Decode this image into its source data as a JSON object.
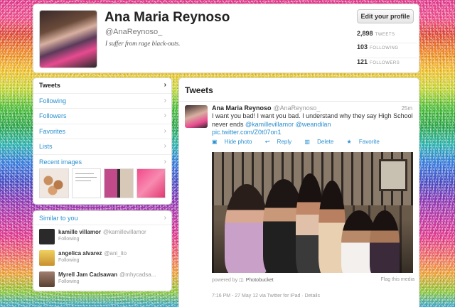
{
  "profile": {
    "name": "Ana Maria Reynoso",
    "handle": "@AnaReynoso_",
    "bio": "I suffer from rage black-outs.",
    "edit_label": "Edit your profile",
    "stats": [
      {
        "value": "2,898",
        "label": "TWEETS"
      },
      {
        "value": "103",
        "label": "FOLLOWING"
      },
      {
        "value": "121",
        "label": "FOLLOWERS"
      }
    ]
  },
  "nav": {
    "items": [
      {
        "label": "Tweets"
      },
      {
        "label": "Following"
      },
      {
        "label": "Followers"
      },
      {
        "label": "Favorites"
      },
      {
        "label": "Lists"
      }
    ],
    "recent_images_label": "Recent images",
    "chevron": "›"
  },
  "similar": {
    "title": "Similar to you",
    "users": [
      {
        "name": "kamille villamor",
        "handle": "@kamillevillamor",
        "status": "Following",
        "color": "#2a2a2a"
      },
      {
        "name": "angelica alvarez",
        "handle": "@ani_ito",
        "status": "Following",
        "color": "#e0b030"
      },
      {
        "name": "Myrell Jam Cadsawan",
        "handle": "@mhycadsa...",
        "status": "Following",
        "color": "#6a5040"
      }
    ]
  },
  "tweets_panel": {
    "title": "Tweets",
    "tweet": {
      "author": "Ana Maria Reynoso",
      "handle": "@AnaReynoso_",
      "time": "25m",
      "text_1": "I want you bad! I want you bad. I understand why they say High School never ends ",
      "mention_1": "@kamillevillamor",
      "mention_2": "@weandilan",
      "link": "pic.twitter.com/Z0t07on1",
      "actions": {
        "hide_photo": "Hide photo",
        "reply": "Reply",
        "delete": "Delete",
        "favorite": "Favorite"
      },
      "powered_by": "powered by",
      "photobucket": "Photobucket",
      "flag": "Flag this media",
      "meta": "7:16 PM - 27 May 12 via Twitter for iPad · Details"
    }
  },
  "colors": {
    "link": "#2a8fd0",
    "text": "#333333"
  }
}
